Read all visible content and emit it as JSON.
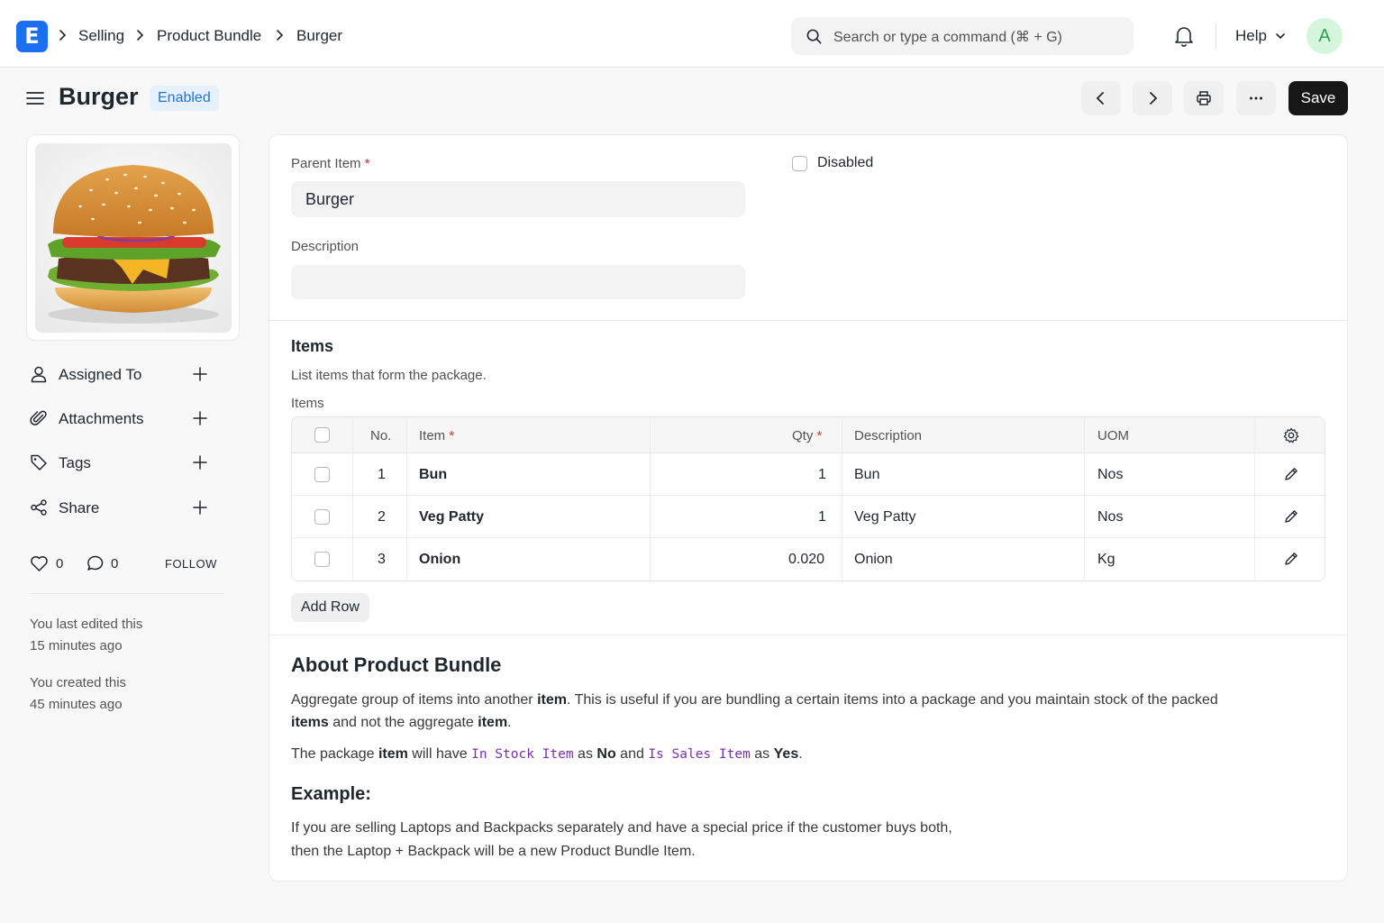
{
  "navbar": {
    "logo_letter": "E",
    "breadcrumbs": [
      "Selling",
      "Product Bundle",
      "Burger"
    ],
    "search_placeholder": "Search or type a command (⌘ + G)",
    "help_label": "Help",
    "avatar_letter": "A"
  },
  "page": {
    "title": "Burger",
    "status": "Enabled",
    "save_label": "Save"
  },
  "sidebar": {
    "items": [
      {
        "label": "Assigned To",
        "icon": "user-icon"
      },
      {
        "label": "Attachments",
        "icon": "paperclip-icon"
      },
      {
        "label": "Tags",
        "icon": "tag-icon"
      },
      {
        "label": "Share",
        "icon": "share-icon"
      }
    ],
    "likes": "0",
    "comments": "0",
    "follow_label": "FOLLOW",
    "edited_line1": "You last edited this",
    "edited_line2": "15 minutes ago",
    "created_line1": "You created this",
    "created_line2": "45 minutes ago"
  },
  "form": {
    "parent_item_label": "Parent Item",
    "parent_item_value": "Burger",
    "disabled_label": "Disabled",
    "description_label": "Description",
    "description_value": ""
  },
  "items_section": {
    "title": "Items",
    "subtitle": "List items that form the package.",
    "table_label": "Items",
    "columns": {
      "no": "No.",
      "item": "Item",
      "qty": "Qty",
      "description": "Description",
      "uom": "UOM"
    },
    "rows": [
      {
        "no": "1",
        "item": "Bun",
        "qty": "1",
        "description": "Bun",
        "uom": "Nos"
      },
      {
        "no": "2",
        "item": "Veg Patty",
        "qty": "1",
        "description": "Veg Patty",
        "uom": "Nos"
      },
      {
        "no": "3",
        "item": "Onion",
        "qty": "0.020",
        "description": "Onion",
        "uom": "Kg"
      }
    ],
    "add_row_label": "Add Row"
  },
  "about": {
    "title": "About Product Bundle",
    "p1_a": "Aggregate group of items into another ",
    "p1_b": "item",
    "p1_c": ". This is useful if you are bundling a certain items into a package and you maintain stock of the packed",
    "p1_d": "items",
    "p1_e": " and not the aggregate ",
    "p1_f": "item",
    "p1_g": ".",
    "p2_a": "The package ",
    "p2_b": "item",
    "p2_c": " will have ",
    "p2_d": "In Stock Item",
    "p2_e": " as ",
    "p2_f": "No",
    "p2_g": " and ",
    "p2_h": "Is Sales Item",
    "p2_i": " as ",
    "p2_j": "Yes",
    "p2_k": ".",
    "example_title": "Example:",
    "ex_line1": "If you are selling Laptops and Backpacks separately and have a special price if the customer buys both,",
    "ex_line2": "then the Laptop + Backpack will be a new Product Bundle Item."
  },
  "colors": {
    "accent": "#1d6ff2",
    "save_bg": "#171717",
    "badge_bg": "#e6f1fd",
    "badge_text": "#1f75d8",
    "code_text": "#7b2fb5",
    "required": "#e03131"
  }
}
